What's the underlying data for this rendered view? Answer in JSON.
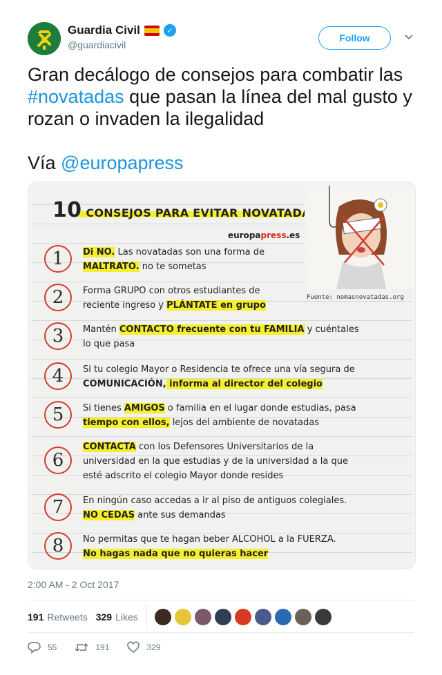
{
  "account": {
    "display_name": "Guardia Civil",
    "handle": "@guardiacivil",
    "verified_icon": "verified-badge-icon",
    "flag_icon": "spain-flag-icon",
    "follow_label": "Follow"
  },
  "tweet": {
    "text_part1": "Gran decálogo de consejos para combatir las",
    "hashtag": "#novatadas",
    "text_part2": " que pasan la línea del mal gusto y rozan o invaden la ilegalidad",
    "via_label": "Vía ",
    "mention": "@europapress",
    "timestamp": "2:00 AM - 2 Oct 2017"
  },
  "image": {
    "title_number": "10",
    "title_text": "CONSEJOS PARA EVITAR NOVATADAS",
    "site_prefix": "europa",
    "site_highlight": "press",
    "site_suffix": ".es",
    "source": "Fuente: nomasnovatadas.org",
    "tips": [
      {
        "number": "1",
        "text_a": "Di NO.",
        "text_b": " Las novatadas son una forma de",
        "text_c": "MALTRATO.",
        "text_d": " no te sometas"
      },
      {
        "number": "2",
        "text_a": "Forma GRUPO con otros estudiantes de",
        "text_b": "reciente ingreso y ",
        "text_c": "PLÁNTATE en grupo",
        "text_d": ""
      },
      {
        "number": "3",
        "text_a": "Mantén ",
        "text_b": "CONTACTO frecuente con tu FAMILIA",
        "text_c": " y cuéntales",
        "text_d": "lo que pasa"
      },
      {
        "number": "4",
        "text_a": "Si tu colegio Mayor o Residencia te ofrece una vía segura de",
        "text_b": "COMUNICACIÓN,",
        "text_c": " informa al director del colegio",
        "text_d": ""
      },
      {
        "number": "5",
        "text_a": "Si tienes ",
        "text_b": "AMIGOS",
        "text_c": " o familia en el lugar donde estudias, pasa",
        "text_d": "tiempo con ellos,",
        "text_e": " lejos del ambiente de novatadas"
      },
      {
        "number": "6",
        "text_a": "CONTACTA",
        "text_b": " con los Defensores Universitarios de la",
        "text_c": "universidad en la que estudias y de la universidad a la que",
        "text_d": "esté adscrito el colegio Mayor donde resides"
      },
      {
        "number": "7",
        "text_a": "En ningún caso accedas a ir al piso de antiguos colegiales.",
        "text_b": "NO CEDAS",
        "text_c": " ante sus demandas",
        "text_d": ""
      },
      {
        "number": "8",
        "text_a": "No permitas que te hagan beber ALCOHOL a la FUERZA.",
        "text_b": "No hagas nada que no quieras hacer",
        "text_c": "",
        "text_d": ""
      }
    ]
  },
  "stats": {
    "retweets_count": "191",
    "retweets_label": "Retweets",
    "likes_count": "329",
    "likes_label": "Likes",
    "liker_avatars": [
      "#3a2a1f",
      "#e7c53a",
      "#7a5a6a",
      "#2f3f55",
      "#d63a22",
      "#4a5a8a",
      "#2a6ab0",
      "#6a6258",
      "#3a3a3a"
    ]
  },
  "actions": {
    "replies": "55",
    "retweets": "191",
    "likes": "329"
  },
  "colors": {
    "accent": "#1da1f2",
    "link": "#1b95e0",
    "highlight": "#f6ef2b",
    "circle_red": "#d33a2c"
  }
}
